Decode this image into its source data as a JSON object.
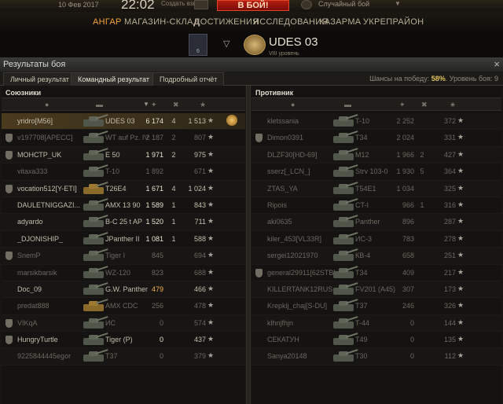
{
  "topbar": {
    "date": "10 Фев 2017",
    "time": "22:02",
    "platoon": "Создать взвод",
    "battle_button": "В БОЙ!",
    "mode": "Случайный бой"
  },
  "menu": {
    "items": [
      "АНГАР",
      "МАГАЗИН-СКЛАД",
      "ДОСТИЖЕНИЯ",
      "ИССЛЕДОВАНИЯ",
      "КАЗАРМА",
      "УКРЕПРАЙОН"
    ],
    "active": "АНГАР"
  },
  "vehicle": {
    "slot_number": "6",
    "name": "UDES 03",
    "level": "VIII уровень"
  },
  "window": {
    "title": "Результаты боя",
    "close": "×",
    "tabs": [
      "Личный результат",
      "Командный результат",
      "Подробный отчёт"
    ],
    "active_tab": "Командный результат",
    "win_chance_label": "Шансы на победу:",
    "win_chance_value": "58%",
    "level_label": "Уровень боя: 9"
  },
  "allies": {
    "title": "Союзники",
    "rows": [
      {
        "name": "yridro[M56]",
        "vehicle": "UDES 03",
        "damage": "6 174",
        "kills": "4",
        "xp": "1 513",
        "clan": false,
        "dead": false,
        "me": true,
        "medal": true
      },
      {
        "name": "v197708[APECC]",
        "vehicle": "WT auf Pz. IV",
        "damage": "2 187",
        "kills": "2",
        "xp": "807",
        "clan": true,
        "dead": true
      },
      {
        "name": "МОНСТР_UK",
        "vehicle": "E 50",
        "damage": "1 971",
        "kills": "2",
        "xp": "975",
        "clan": true,
        "dead": false
      },
      {
        "name": "vitaxa333",
        "vehicle": "T-10",
        "damage": "1 892",
        "kills": "",
        "xp": "671",
        "clan": false,
        "dead": true
      },
      {
        "name": "vocation512[Y-ETI]",
        "vehicle": "T26E4",
        "damage": "1 671",
        "kills": "4",
        "xp": "1 024",
        "clan": true,
        "dead": false,
        "gold": true
      },
      {
        "name": "DAULETNIGGAZI...",
        "vehicle": "AMX 13 90",
        "damage": "1 589",
        "kills": "1",
        "xp": "843",
        "clan": false,
        "dead": false
      },
      {
        "name": "adyardo",
        "vehicle": "B-C 25 t AP",
        "damage": "1 520",
        "kills": "1",
        "xp": "711",
        "clan": false,
        "dead": false
      },
      {
        "name": "_DJONISHIP_",
        "vehicle": "JPanther II",
        "damage": "1 081",
        "kills": "1",
        "xp": "588",
        "clan": false,
        "dead": false
      },
      {
        "name": "SnemP",
        "vehicle": "Tiger I",
        "damage": "845",
        "kills": "",
        "xp": "694",
        "clan": true,
        "dead": true
      },
      {
        "name": "marsikbarsik",
        "vehicle": "WZ-120",
        "damage": "823",
        "kills": "",
        "xp": "688",
        "clan": false,
        "dead": true
      },
      {
        "name": "Doc_09",
        "vehicle": "G.W. Panther",
        "damage": "479",
        "kills": "",
        "xp": "466",
        "clan": false,
        "dead": false,
        "orange": true
      },
      {
        "name": "predat888",
        "vehicle": "AMX CDC",
        "damage": "256",
        "kills": "",
        "xp": "478",
        "clan": false,
        "dead": true,
        "gold": true
      },
      {
        "name": "VIKqA",
        "vehicle": "ИС",
        "damage": "0",
        "kills": "",
        "xp": "574",
        "clan": true,
        "dead": true
      },
      {
        "name": "HungryTurtle",
        "vehicle": "Tiger (P)",
        "damage": "0",
        "kills": "",
        "xp": "437",
        "clan": true,
        "dead": false
      },
      {
        "name": "9225844445egor",
        "vehicle": "T37",
        "damage": "0",
        "kills": "",
        "xp": "379",
        "clan": false,
        "dead": true
      }
    ]
  },
  "enemies": {
    "title": "Противник",
    "rows": [
      {
        "name": "kletssania",
        "vehicle": "T-10",
        "damage": "2 252",
        "kills": "",
        "xp": "372",
        "clan": false,
        "dead": true
      },
      {
        "name": "Dimon0391",
        "vehicle": "T34",
        "damage": "2 024",
        "kills": "",
        "xp": "331",
        "clan": true,
        "dead": true
      },
      {
        "name": "DLZF30[HD-69]",
        "vehicle": "M12",
        "damage": "1 966",
        "kills": "2",
        "xp": "427",
        "clan": false,
        "dead": true
      },
      {
        "name": "sserz[_LCN_]",
        "vehicle": "Strv 103-0",
        "damage": "1 930",
        "kills": "5",
        "xp": "364",
        "clan": false,
        "dead": true
      },
      {
        "name": "ZTAS_YA",
        "vehicle": "T54E1",
        "damage": "1 034",
        "kills": "",
        "xp": "325",
        "clan": false,
        "dead": true
      },
      {
        "name": "Ripois",
        "vehicle": "CT-I",
        "damage": "966",
        "kills": "1",
        "xp": "316",
        "clan": false,
        "dead": true
      },
      {
        "name": "aki0635",
        "vehicle": "Panther",
        "damage": "896",
        "kills": "",
        "xp": "287",
        "clan": false,
        "dead": true
      },
      {
        "name": "kiler_453[VL33R]",
        "vehicle": "ИС-3",
        "damage": "783",
        "kills": "",
        "xp": "278",
        "clan": false,
        "dead": true
      },
      {
        "name": "sergei12021970",
        "vehicle": "КВ-4",
        "damage": "658",
        "kills": "",
        "xp": "251",
        "clan": false,
        "dead": true
      },
      {
        "name": "general29911[62STB]",
        "vehicle": "T34",
        "damage": "409",
        "kills": "",
        "xp": "217",
        "clan": true,
        "dead": true
      },
      {
        "name": "KILLERTANK12RUS",
        "vehicle": "FV201 (A45)",
        "damage": "307",
        "kills": "",
        "xp": "173",
        "clan": false,
        "dead": true
      },
      {
        "name": "Krepkij_chaj[S-DU]",
        "vehicle": "T37",
        "damage": "246",
        "kills": "",
        "xp": "326",
        "clan": false,
        "dead": true
      },
      {
        "name": "klhnjfhjn",
        "vehicle": "T-44",
        "damage": "0",
        "kills": "",
        "xp": "144",
        "clan": false,
        "dead": true
      },
      {
        "name": "СЕКАТУН",
        "vehicle": "T49",
        "damage": "0",
        "kills": "",
        "xp": "135",
        "clan": false,
        "dead": true
      },
      {
        "name": "Sanya20148",
        "vehicle": "T30",
        "damage": "0",
        "kills": "",
        "xp": "112",
        "clan": false,
        "dead": true
      }
    ]
  },
  "icons": {
    "player": "person-icon",
    "vehicle": "tank-icon",
    "damage": "damage-icon",
    "kills": "kills-icon",
    "xp": "star-icon",
    "star": "★",
    "sort": "▼"
  }
}
